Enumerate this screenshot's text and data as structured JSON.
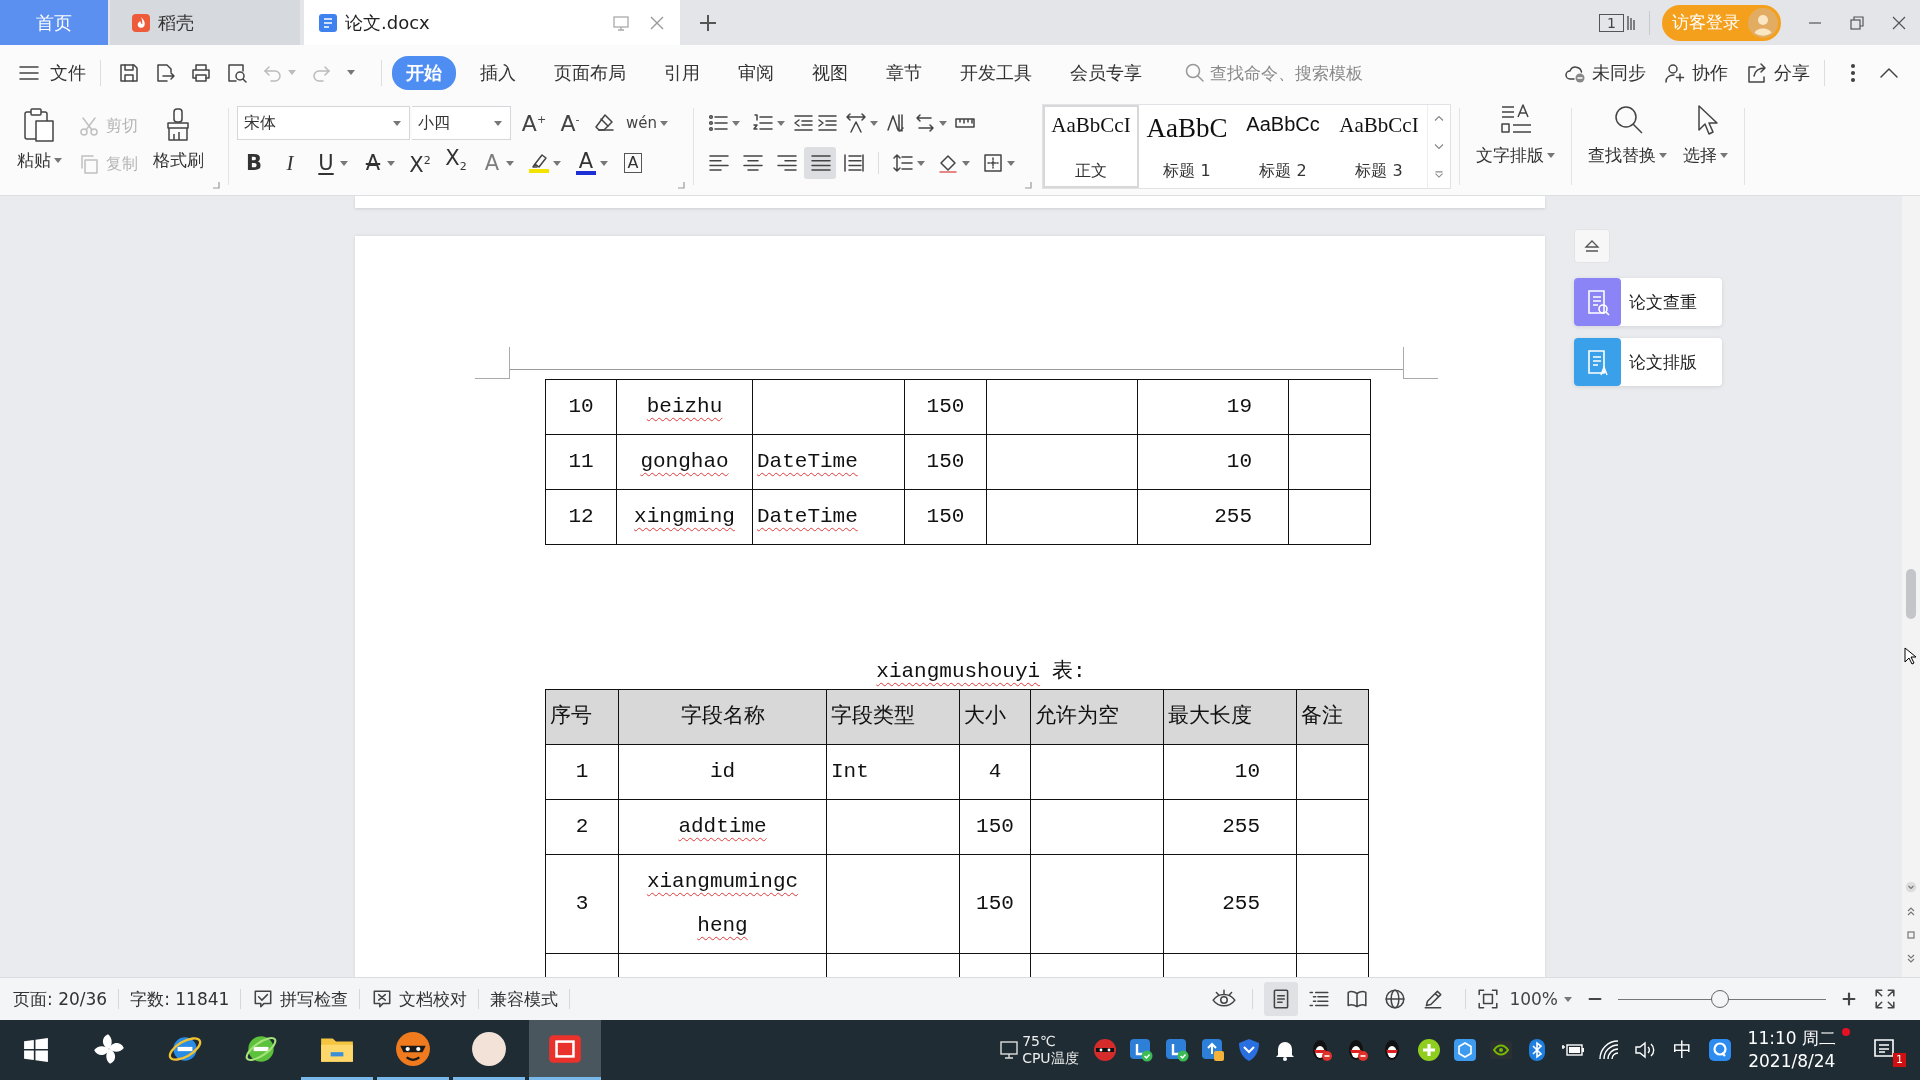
{
  "tabbar": {
    "tabs": [
      {
        "label": "首页",
        "kind": "home",
        "selected": false
      },
      {
        "label": "稻壳",
        "kind": "app",
        "selected": false
      },
      {
        "label": "论文.docx",
        "kind": "doc",
        "selected": true
      }
    ],
    "window_count": "1",
    "login": "访客登录"
  },
  "menubar": {
    "file": "文件",
    "undo": {
      "disabled": true
    },
    "redo": {
      "disabled": true
    },
    "tabs": [
      {
        "label": "开始",
        "selected": true
      },
      {
        "label": "插入",
        "selected": false
      },
      {
        "label": "页面布局",
        "selected": false
      },
      {
        "label": "引用",
        "selected": false
      },
      {
        "label": "审阅",
        "selected": false
      },
      {
        "label": "视图",
        "selected": false
      },
      {
        "label": "章节",
        "selected": false
      },
      {
        "label": "开发工具",
        "selected": false
      },
      {
        "label": "会员专享",
        "selected": false
      }
    ],
    "search": {
      "placeholder": "查找命令、搜索模板"
    },
    "sync": "未同步",
    "collaborate": "协作",
    "share": "分享"
  },
  "ribbon": {
    "paste": "粘贴",
    "cut": {
      "label": "剪切",
      "disabled": true
    },
    "copy": {
      "label": "复制",
      "disabled": true
    },
    "format_painter": "格式刷",
    "font_family": "宋体",
    "font_size": "小四",
    "size_buttons": [
      "A$^{+}$",
      "A$^{-}$"
    ],
    "phonetic": "wén",
    "format_buttons": [
      {
        "kind": "bold",
        "text": "B"
      },
      {
        "kind": "italic",
        "text": "I"
      },
      {
        "kind": "underline",
        "text": "U"
      },
      {
        "kind": "strike",
        "text": "A"
      },
      {
        "kind": "superscript",
        "text": "X$^{2}$"
      },
      {
        "kind": "subscript",
        "text": "X$_{2}$"
      },
      {
        "kind": "effect",
        "text": "A"
      },
      {
        "kind": "highlight",
        "color": "#f2e400"
      },
      {
        "kind": "color",
        "text": "A",
        "color": "#1e2fd6"
      },
      {
        "kind": "border",
        "text": "A"
      }
    ],
    "align_buttons": [
      {
        "selected": false
      },
      {
        "selected": false
      },
      {
        "selected": false
      },
      {
        "selected": true
      },
      {
        "selected": false
      }
    ],
    "styles": [
      {
        "kind": "body",
        "sample": "AaBbCcI",
        "label": "正文",
        "selected": true
      },
      {
        "kind": "h1",
        "sample": "AaBbC",
        "label": "标题 1",
        "selected": false
      },
      {
        "kind": "h2",
        "sample": "AaBbCc",
        "label": "标题 2",
        "selected": false
      },
      {
        "kind": "h3",
        "sample": "AaBbCcI",
        "label": "标题 3",
        "selected": false
      }
    ],
    "text_layout": "文字排版",
    "find_replace": "查找替换",
    "select": "选择"
  },
  "document": {
    "table_1": {
      "rows": [
        [
          {
            "text": "10",
            "misspelled": false
          },
          {
            "text": "beizhu",
            "misspelled": true
          },
          null,
          {
            "text": "150",
            "misspelled": false
          },
          null,
          {
            "text": "19",
            "misspelled": false
          },
          null
        ],
        [
          {
            "text": "11",
            "misspelled": false
          },
          {
            "text": "gonghao",
            "misspelled": true
          },
          {
            "text": "DateTime",
            "misspelled": true
          },
          {
            "text": "150",
            "misspelled": false
          },
          null,
          {
            "text": "10",
            "misspelled": false
          },
          null
        ],
        [
          {
            "text": "12",
            "misspelled": false
          },
          {
            "text": "xingming",
            "misspelled": true
          },
          {
            "text": "DateTime",
            "misspelled": true
          },
          {
            "text": "150",
            "misspelled": false
          },
          null,
          {
            "text": "255",
            "misspelled": false
          },
          null
        ]
      ]
    },
    "caption": [
      {
        "text": "xiangmushouyi",
        "misspelled": true
      },
      {
        "text": "表:",
        "misspelled": false
      }
    ],
    "table_2": {
      "header": [
        "序号",
        "字段名称",
        "字段类型",
        "大小",
        "允许为空",
        "最大长度",
        "备注"
      ],
      "rows": [
        [
          {
            "text": "1",
            "misspelled": false
          },
          {
            "text": "id",
            "misspelled": false
          },
          {
            "text": "Int",
            "misspelled": false
          },
          {
            "text": "4",
            "misspelled": false
          },
          null,
          {
            "text": "10",
            "misspelled": false
          },
          null
        ],
        [
          {
            "text": "2",
            "misspelled": false
          },
          {
            "text": "addtime",
            "misspelled": true
          },
          null,
          {
            "text": "150",
            "misspelled": false
          },
          null,
          {
            "text": "255",
            "misspelled": false
          },
          null
        ],
        [
          {
            "text": "3",
            "misspelled": false
          },
          {
            "text": "xiangmumingcheng",
            "misspelled": true
          },
          null,
          {
            "text": "150",
            "misspelled": false
          },
          null,
          {
            "text": "255",
            "misspelled": false
          },
          null
        ],
        [
          null,
          null,
          null,
          null,
          null,
          null,
          null
        ]
      ]
    }
  },
  "side_panel": {
    "items": [
      {
        "label": "论文查重",
        "color": "#8a84f6"
      },
      {
        "label": "论文排版",
        "color": "#3aa0e9"
      }
    ]
  },
  "statusbar": {
    "page": "页面: 20/36",
    "words": "字数: 11841",
    "spell_check": "拼写检查",
    "proofread": "文档校对",
    "compat_mode": "兼容模式",
    "view_modes": [
      {
        "selected": true
      },
      {
        "selected": false
      },
      {
        "selected": false
      },
      {
        "selected": false
      },
      {
        "selected": false
      }
    ],
    "zoom": {
      "value": "100%",
      "level": 0.49
    }
  },
  "taskbar": {
    "apps": [
      {
        "running": false,
        "selected": false
      },
      {
        "running": false,
        "selected": false
      },
      {
        "running": false,
        "selected": false
      },
      {
        "running": true,
        "selected": false
      },
      {
        "running": true,
        "selected": false
      },
      {
        "running": true,
        "selected": false
      },
      {
        "running": true,
        "selected": true
      }
    ],
    "cpu_temp": "75℃",
    "cpu_label": "CPU温度",
    "ime": "中",
    "time": "11:10 周二",
    "date": "2021/8/24",
    "notification_count": "1"
  }
}
